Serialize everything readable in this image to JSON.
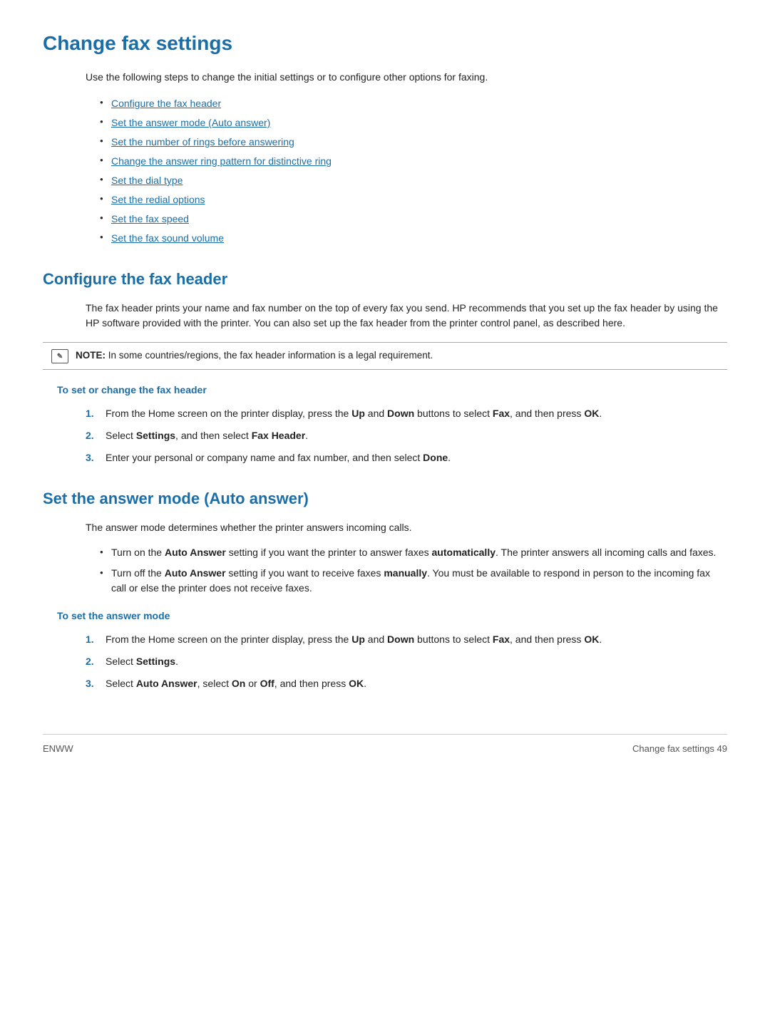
{
  "page": {
    "title": "Change fax settings",
    "intro": "Use the following steps to change the initial settings or to configure other options for faxing.",
    "links": [
      "Configure the fax header",
      "Set the answer mode (Auto answer)",
      "Set the number of rings before answering",
      "Change the answer ring pattern for distinctive ring",
      "Set the dial type",
      "Set the redial options",
      "Set the fax speed",
      "Set the fax sound volume"
    ],
    "sections": {
      "configure_fax_header": {
        "title": "Configure the fax header",
        "body": "The fax header prints your name and fax number on the top of every fax you send. HP recommends that you set up the fax header by using the HP software provided with the printer. You can also set up the fax header from the printer control panel, as described here.",
        "note_label": "NOTE:",
        "note_text": "In some countries/regions, the fax header information is a legal requirement.",
        "subsection_title": "To set or change the fax header",
        "steps": [
          "From the Home screen on the printer display, press the Up and Down buttons to select Fax, and then press OK.",
          "Select Settings, and then select Fax Header.",
          "Enter your personal or company name and fax number, and then select Done."
        ]
      },
      "set_answer_mode": {
        "title": "Set the answer mode (Auto answer)",
        "intro": "The answer mode determines whether the printer answers incoming calls.",
        "bullets": [
          "Turn on the Auto Answer setting if you want the printer to answer faxes automatically. The printer answers all incoming calls and faxes.",
          "Turn off the Auto Answer setting if you want to receive faxes manually. You must be available to respond in person to the incoming fax call or else the printer does not receive faxes."
        ],
        "subsection_title": "To set the answer mode",
        "steps": [
          "From the Home screen on the printer display, press the Up and Down buttons to select Fax, and then press OK.",
          "Select Settings.",
          "Select Auto Answer, select On or Off, and then press OK."
        ]
      }
    },
    "footer": {
      "left": "ENWW",
      "right": "Change fax settings     49"
    }
  }
}
